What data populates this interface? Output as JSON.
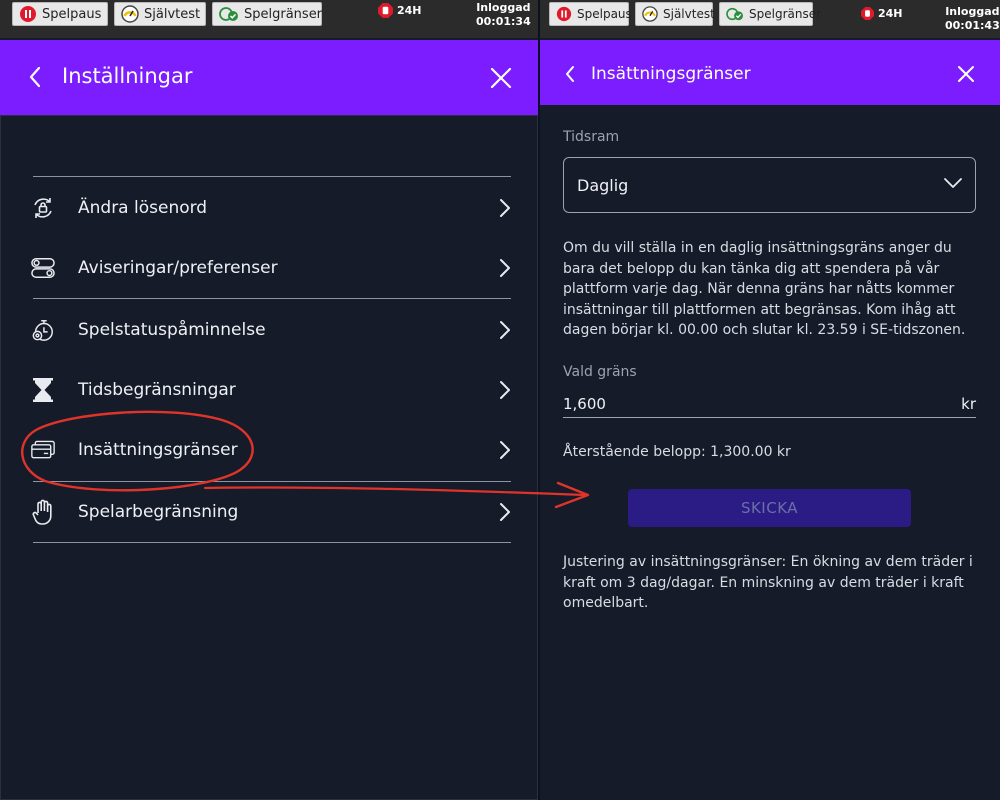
{
  "left": {
    "toolbar": {
      "pause_label": "Spelpaus",
      "selftest_label": "Självtest",
      "limits_label": "Spelgränser",
      "stop_badge": "24H",
      "login_label": "Inloggad",
      "login_time": "00:01:34"
    },
    "header": {
      "title": "Inställningar"
    },
    "menu": [
      {
        "label": "Ändra lösenord",
        "icon": "lock-refresh-icon"
      },
      {
        "label": "Aviseringar/preferenser",
        "icon": "toggles-icon"
      },
      {
        "label": "Spelstatuspåminnelse",
        "icon": "stopwatch-icon"
      },
      {
        "label": "Tidsbegränsningar",
        "icon": "hourglass-icon"
      },
      {
        "label": "Insättningsgränser",
        "icon": "credit-card-icon"
      },
      {
        "label": "Spelarbegränsning",
        "icon": "hand-icon"
      }
    ]
  },
  "right": {
    "toolbar": {
      "pause_label": "Spelpaus",
      "selftest_label": "Självtest",
      "limits_label": "Spelgränser",
      "stop_badge": "24H",
      "login_label": "Inloggad",
      "login_time": "00:01:43"
    },
    "header": {
      "title": "Insättningsgränser"
    },
    "timeframe_label": "Tidsram",
    "timeframe_value": "Daglig",
    "description": "Om du vill ställa in en daglig insättningsgräns anger du bara det belopp du kan tänka dig att spendera på vår plattform varje dag. När denna gräns har nåtts kommer insättningar till plattformen att begränsas. Kom ihåg att dagen börjar kl. 00.00 och slutar kl. 23.59 i SE-tidszonen.",
    "limit_label": "Vald gräns",
    "limit_value": "1,600",
    "currency": "kr",
    "remaining": "Återstående belopp: 1,300.00 kr",
    "submit_label": "SKICKA",
    "adjustment_note": "Justering av insättningsgränser: En ökning av dem träder i kraft om 3 dag/dagar. En minskning av dem träder i kraft omedelbart."
  },
  "colors": {
    "accent": "#7b1dfe",
    "background": "#151b28",
    "button_disabled": "#2b1b85",
    "annotation": "#e0342b"
  }
}
